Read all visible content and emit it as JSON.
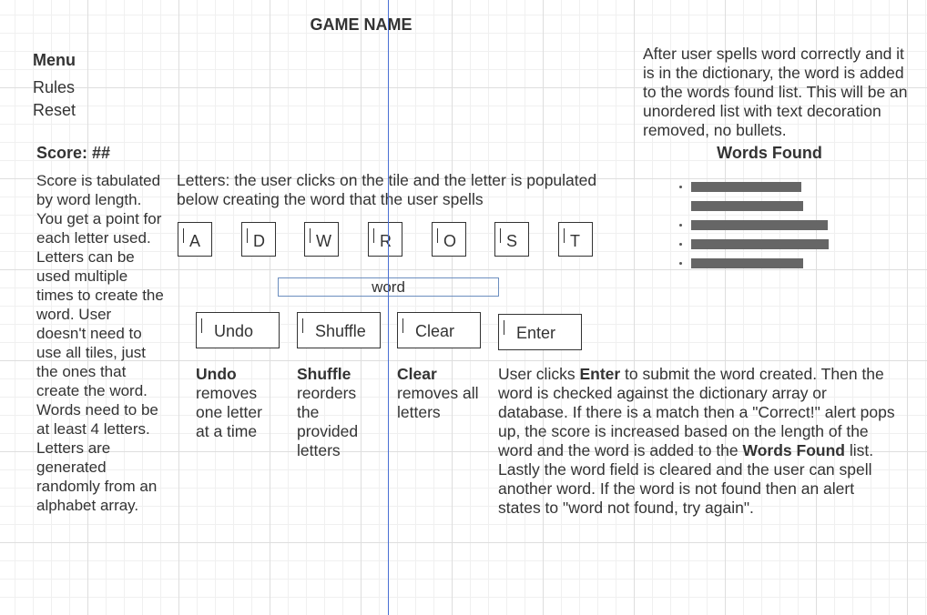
{
  "game_title": "GAME NAME",
  "menu": {
    "title": "Menu",
    "items": [
      "Rules",
      "Reset"
    ]
  },
  "score": {
    "label": "Score: ##",
    "description": "Score is tabulated by word length. You get a point for each letter used. Letters can be used multiple times to create the word. User doesn't need to use all tiles, just the ones that create the word. Words need to be at least 4 letters. Letters are generated randomly from an alphabet array."
  },
  "letters": {
    "description": "Letters: the user clicks on the tile and the letter is populated below creating the word that the user spells",
    "tiles": [
      "A",
      "D",
      "W",
      "R",
      "O",
      "S",
      "T"
    ]
  },
  "word_field": {
    "value": "word"
  },
  "buttons": {
    "undo": {
      "label": "Undo",
      "desc_title": "Undo",
      "desc_text": "removes one letter at a time"
    },
    "shuffle": {
      "label": "Shuffle",
      "desc_title": "Shuffle",
      "desc_text": "reorders the provided letters"
    },
    "clear": {
      "label": "Clear",
      "desc_title": "Clear",
      "desc_text": "removes all letters"
    },
    "enter": {
      "label": "Enter"
    }
  },
  "enter_description": {
    "part1": "User clicks ",
    "bold1": "Enter",
    "part2": " to submit the word created. Then the word is checked against the dictionary array or database. If there is a match then a \"Correct!\" alert pops up, the score is increased based on the length of the word and the word is added to the ",
    "bold2": "Words Found",
    "part3": " list. Lastly the word field is cleared and the user can spell another word. If the word is not found then an alert states to \"word not found, try again\"."
  },
  "words_found": {
    "description": "After user spells word correctly and it is in the dictionary, the word is added to the words found list. This will be an unordered list with text decoration removed, no bullets.",
    "title": "Words Found"
  },
  "colors": {
    "text": "#333333",
    "guide_line": "#4a6fd4",
    "word_box_border": "#6c8ebf",
    "placeholder_bar": "#666666"
  }
}
